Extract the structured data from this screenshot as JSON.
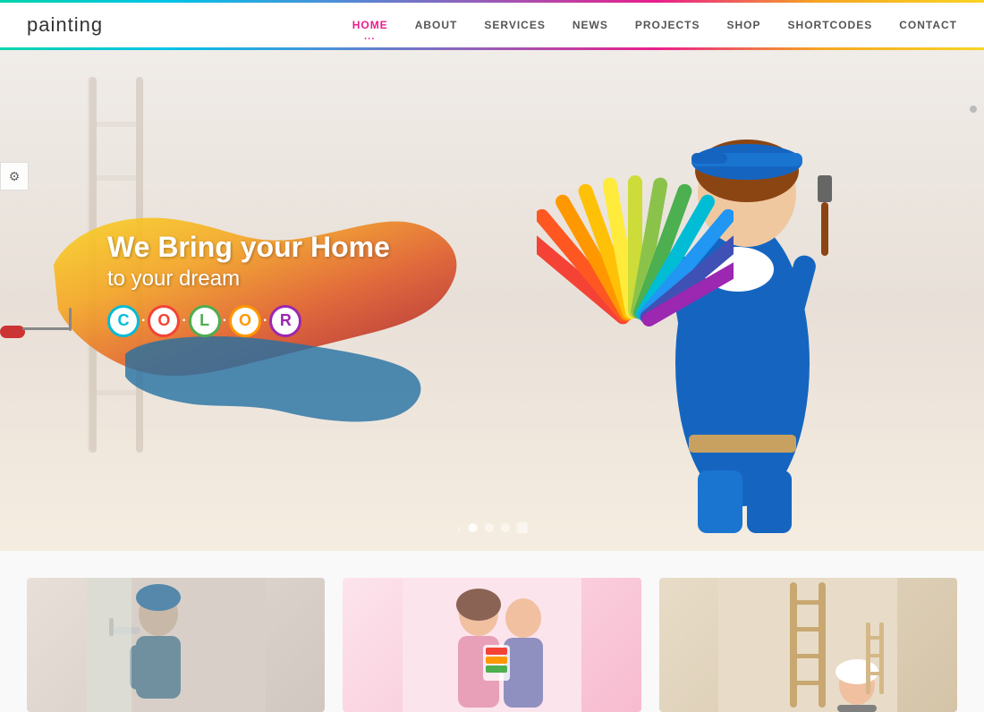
{
  "header": {
    "logo": "painting",
    "nav": [
      {
        "label": "HOME",
        "active": true
      },
      {
        "label": "ABOUT",
        "active": false
      },
      {
        "label": "SERVICES",
        "active": false
      },
      {
        "label": "NEWS",
        "active": false
      },
      {
        "label": "PROJECTS",
        "active": false
      },
      {
        "label": "SHOP",
        "active": false
      },
      {
        "label": "SHORTCODES",
        "active": false
      },
      {
        "label": "CONTACT",
        "active": false
      }
    ]
  },
  "hero": {
    "line1": "We Bring your Home",
    "line2": "to your dream",
    "color_word": "C·O·L·O·R",
    "color_letters": [
      {
        "letter": "C",
        "color": "#00bcd4",
        "border": "#00bcd4"
      },
      {
        "letter": "O",
        "color": "#f44336",
        "border": "#f44336"
      },
      {
        "letter": "L",
        "color": "#4caf50",
        "border": "#4caf50"
      },
      {
        "letter": "O",
        "color": "#ff9800",
        "border": "#ff9800"
      },
      {
        "letter": "R",
        "color": "#9c27b0",
        "border": "#9c27b0"
      }
    ],
    "dots": [
      "active",
      "inactive",
      "inactive",
      "inactive"
    ],
    "settings_icon": "⚙"
  },
  "bottom": {
    "cards": [
      {
        "id": "card-1",
        "alt": "Painter at work"
      },
      {
        "id": "card-2",
        "alt": "Couple looking at swatches"
      },
      {
        "id": "card-3",
        "alt": "Ladder and worker"
      }
    ]
  },
  "colors": {
    "brand_pink": "#e91e8c",
    "gradient_bar": "linear-gradient(to right, #00d4aa, #00c4e8, #4a90d9, #9b59b6, #e91e8c, #f5a623, #f9d423)"
  }
}
